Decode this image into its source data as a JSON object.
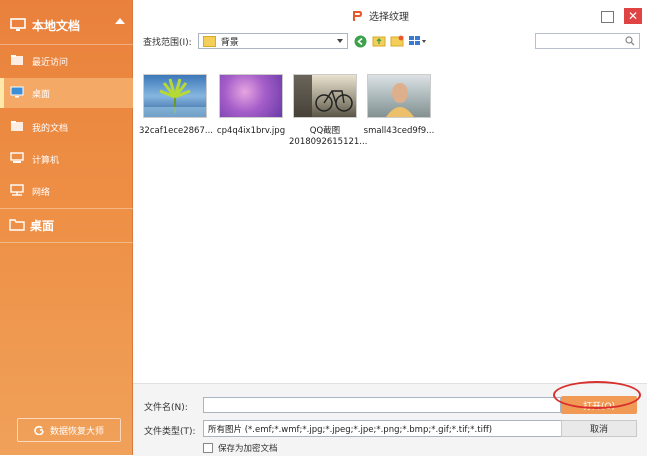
{
  "sidebar": {
    "local_docs": "本地文档",
    "items": [
      {
        "label": "最近访问",
        "icon": "recent-folder-icon"
      },
      {
        "label": "桌面",
        "icon": "monitor-icon"
      },
      {
        "label": "我的文档",
        "icon": "documents-folder-icon"
      },
      {
        "label": "计算机",
        "icon": "computer-icon"
      },
      {
        "label": "网络",
        "icon": "network-icon"
      }
    ],
    "desktop_section": "桌面",
    "recover_button": "数据恢复大师"
  },
  "dialog": {
    "title": "选择纹理",
    "look_in_label": "查找范围(I):",
    "look_in_value": "背景",
    "search_placeholder": ""
  },
  "files": [
    {
      "name": "32caf1ece2867...",
      "name2": ""
    },
    {
      "name": "cp4q4ix1brv.jpg",
      "name2": ""
    },
    {
      "name": "QQ截图",
      "name2": "2018092615121..."
    },
    {
      "name": "small43ced9f9...",
      "name2": ""
    }
  ],
  "bottom": {
    "filename_label": "文件名(N):",
    "filename_value": "",
    "filetype_label": "文件类型(T):",
    "filetype_value": "所有图片 (*.emf;*.wmf;*.jpg;*.jpeg;*.jpe;*.png;*.bmp;*.gif;*.tif;*.tiff)",
    "open_button": "打开(O)",
    "cancel_button": "取消",
    "save_encrypted": "保存为加密文档"
  },
  "colors": {
    "accent": "#ee8f45",
    "highlight_ring": "#d9302c"
  }
}
